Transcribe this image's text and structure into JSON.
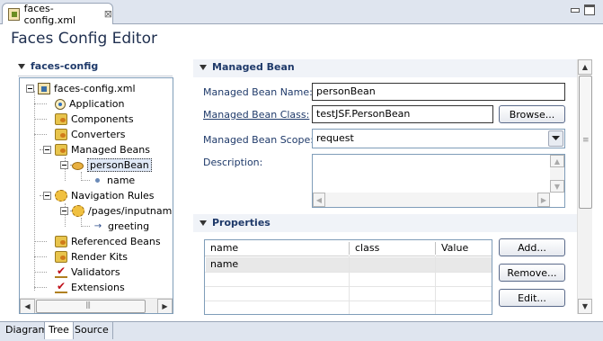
{
  "editor_tab": {
    "filename": "faces-config.xml",
    "close": "⊠"
  },
  "title": "Faces Config Editor",
  "left": {
    "section_title": "faces-config",
    "tree": [
      {
        "label": "faces-config.xml"
      },
      {
        "label": "Application"
      },
      {
        "label": "Components"
      },
      {
        "label": "Converters"
      },
      {
        "label": "Managed Beans"
      },
      {
        "label": "personBean"
      },
      {
        "label": "name"
      },
      {
        "label": "Navigation Rules"
      },
      {
        "label": "/pages/inputname"
      },
      {
        "label": "greeting"
      },
      {
        "label": "Referenced Beans"
      },
      {
        "label": "Render Kits"
      },
      {
        "label": "Validators"
      },
      {
        "label": "Extensions"
      }
    ]
  },
  "managed_bean": {
    "section_title": "Managed Bean",
    "name_label": "Managed Bean Name:",
    "name_value": "personBean",
    "class_label": "Managed Bean Class:",
    "class_value": "testJSF.PersonBean",
    "browse_label": "Browse...",
    "scope_label": "Managed Bean Scope:",
    "scope_value": "request",
    "description_label": "Description:"
  },
  "properties": {
    "section_title": "Properties",
    "columns": [
      "name",
      "class",
      "Value"
    ],
    "rows": [
      {
        "name": "name",
        "class": "",
        "value": ""
      }
    ],
    "add_label": "Add...",
    "remove_label": "Remove...",
    "edit_label": "Edit..."
  },
  "bottom_tabs": [
    "Diagram",
    "Tree",
    "Source"
  ],
  "active_bottom_tab": "Tree"
}
